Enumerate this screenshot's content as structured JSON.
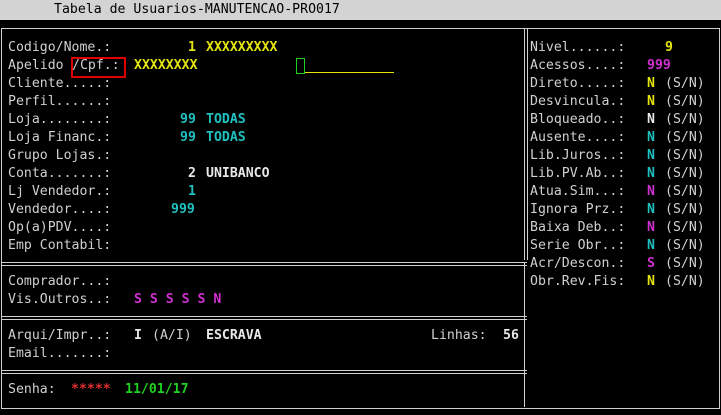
{
  "window": {
    "title": "Tabela de Usuarios-MANUTENCAO-PRO017"
  },
  "left": {
    "codigo_label": "Codigo/Nome.:",
    "codigo_value": "1",
    "nome_value": "XXXXXXXXX",
    "apelido_label": "Apelido",
    "cpf_label": "/Cpf.:",
    "apelido_value": "XXXXXXXX",
    "cliente_label": "Cliente.....:",
    "perfil_label": "Perfil......:",
    "loja_label": "Loja........:",
    "loja_code": "99",
    "loja_name": "TODAS",
    "loja_financ_label": "Loja Financ.:",
    "loja_financ_code": "99",
    "loja_financ_name": "TODAS",
    "grupo_lojas_label": "Grupo Lojas.:",
    "conta_label": "Conta.......:",
    "conta_code": "2",
    "conta_name": "UNIBANCO",
    "lj_vendedor_label": "Lj Vendedor.:",
    "lj_vendedor_value": "1",
    "vendedor_label": "Vendedor....:",
    "vendedor_value": "999",
    "op_pdv_label": "Op(a)PDV....:",
    "emp_contabil_label": "Emp Contabil:",
    "comprador_label": "Comprador...:",
    "vis_outros_label": "Vis.Outros..:",
    "vis_outros_value": "S S S S S N",
    "arqui_label": "Arqui/Impr..:",
    "arqui_value": "I",
    "arqui_options": "(A/I)",
    "arqui_mode": "ESCRAVA",
    "linhas_label": "Linhas:",
    "linhas_value": "56",
    "email_label": "Email.......:",
    "senha_label": "Senha:",
    "senha_value": "*****",
    "senha_date": "11/01/17"
  },
  "right": {
    "nivel_label": "Nivel......:",
    "nivel_value": "9",
    "acessos_label": "Acessos....:",
    "acessos_value": "999",
    "flags": [
      {
        "label": "Direto.....:",
        "value": "N",
        "opts": "(S/N)",
        "color": "y"
      },
      {
        "label": "Desvincula.:",
        "value": "N",
        "opts": "(S/N)",
        "color": "y"
      },
      {
        "label": "Bloqueado..:",
        "value": "N",
        "opts": "(S/N)",
        "color": "w"
      },
      {
        "label": "Ausente....:",
        "value": "N",
        "opts": "(S/N)",
        "color": "c"
      },
      {
        "label": "Lib.Juros..:",
        "value": "N",
        "opts": "(S/N)",
        "color": "c"
      },
      {
        "label": "Lib.PV.Ab..:",
        "value": "N",
        "opts": "(S/N)",
        "color": "c"
      },
      {
        "label": "Atua.Sim...:",
        "value": "N",
        "opts": "(S/N)",
        "color": "m"
      },
      {
        "label": "Ignora Prz.:",
        "value": "N",
        "opts": "(S/N)",
        "color": "c"
      },
      {
        "label": "Baixa Deb..:",
        "value": "N",
        "opts": "(S/N)",
        "color": "m"
      },
      {
        "label": "Serie Obr..:",
        "value": "N",
        "opts": "(S/N)",
        "color": "c"
      },
      {
        "label": "Acr/Descon.:",
        "value": "S",
        "opts": "(S/N)",
        "color": "m"
      },
      {
        "label": "Obr.Rev.Fis:",
        "value": "N",
        "opts": "(S/N)",
        "color": "y"
      }
    ]
  }
}
